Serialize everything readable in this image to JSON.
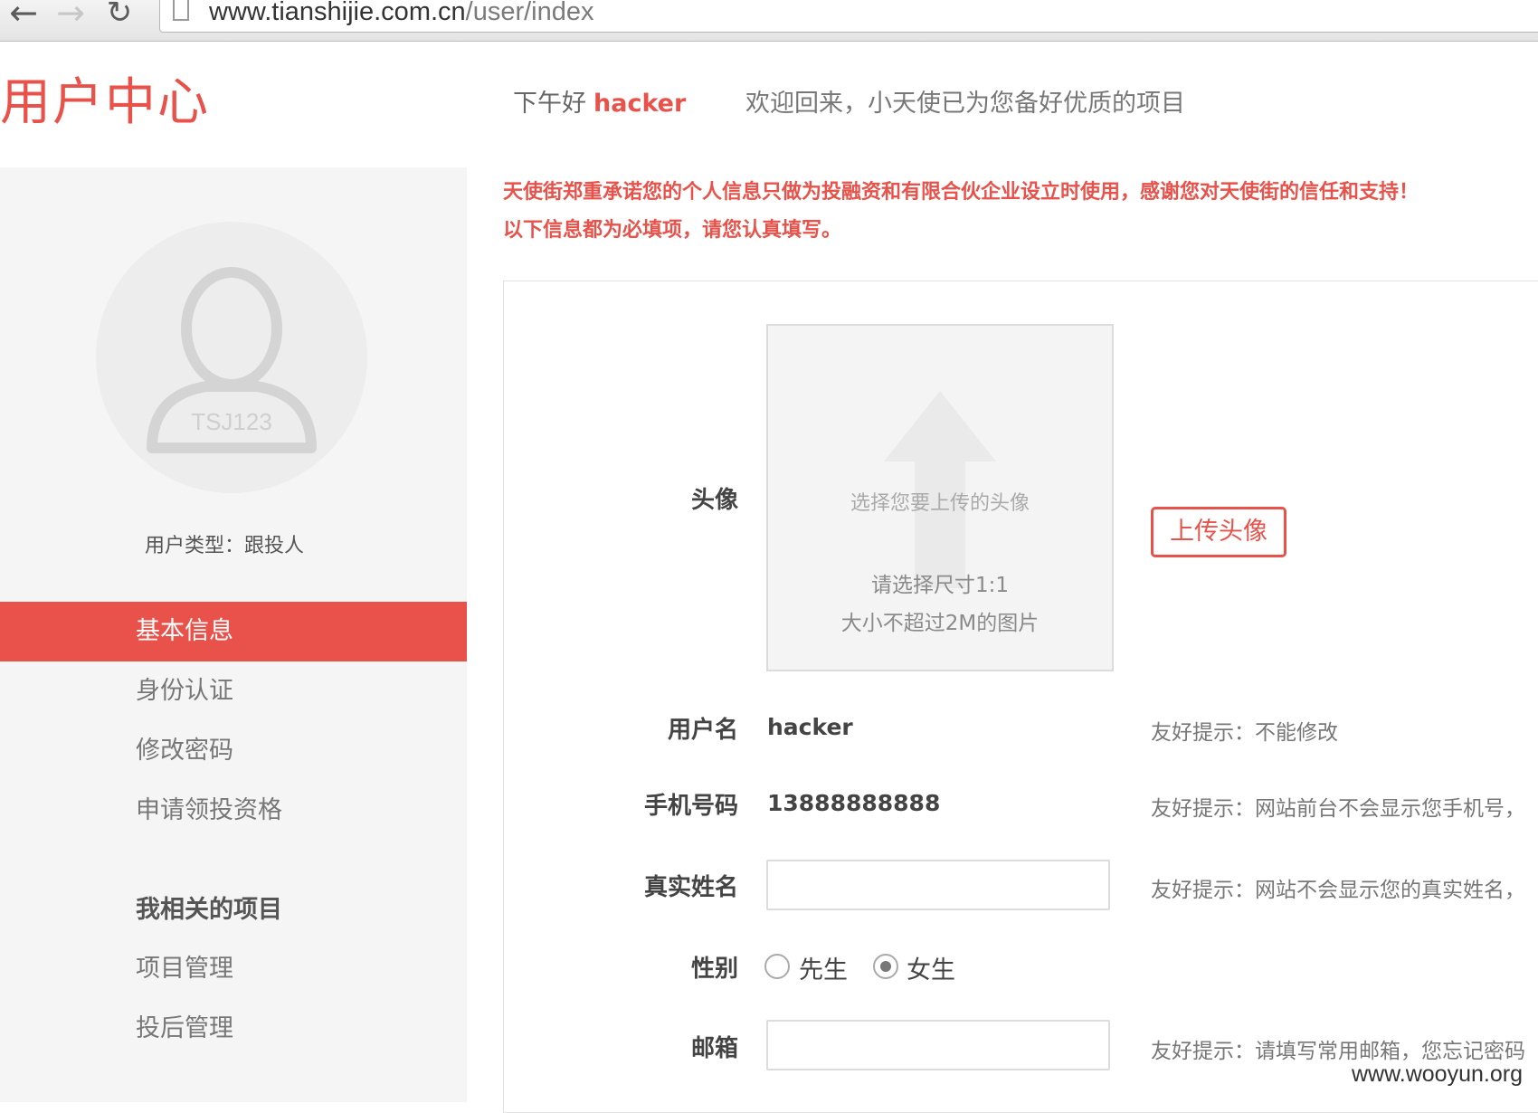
{
  "browser": {
    "url_host": "www.tianshijie.com.cn",
    "url_path": "/user/index",
    "icons": [
      "back-arrow-icon",
      "forward-arrow-icon",
      "reload-icon",
      "page-icon"
    ]
  },
  "header": {
    "title": "用户中心",
    "greeting": "下午好",
    "username": "hacker",
    "welcome": "欢迎回来，小天使已为您备好优质的项目"
  },
  "sidebar": {
    "avatar_text": "TSJ123",
    "user_type": "用户类型：跟投人",
    "menu": [
      {
        "label": "基本信息",
        "active": true
      },
      {
        "label": "身份认证",
        "active": false
      },
      {
        "label": "修改密码",
        "active": false
      },
      {
        "label": "申请领投资格",
        "active": false
      }
    ],
    "section_heading": "我相关的项目",
    "project_menu": [
      {
        "label": "项目管理"
      },
      {
        "label": "投后管理"
      }
    ]
  },
  "notice": {
    "line1": "天使街郑重承诺您的个人信息只做为投融资和有限合伙企业设立时使用，感谢您对天使街的信任和支持！",
    "line2": "以下信息都为必填项，请您认真填写。"
  },
  "form": {
    "avatar": {
      "label": "头像",
      "upload_hint": "选择您要上传的头像",
      "size_line1": "请选择尺寸1:1",
      "size_line2": "大小不超过2M的图片",
      "button": "上传头像"
    },
    "username": {
      "label": "用户名",
      "value": "hacker",
      "hint": "友好提示：不能修改"
    },
    "phone": {
      "label": "手机号码",
      "value": "13888888888",
      "hint": "友好提示：网站前台不会显示您手机号，"
    },
    "real_name": {
      "label": "真实姓名",
      "value": "",
      "hint": "友好提示：网站不会显示您的真实姓名，"
    },
    "gender": {
      "label": "性别",
      "options": [
        {
          "label": "先生",
          "checked": false
        },
        {
          "label": "女生",
          "checked": true
        }
      ]
    },
    "email": {
      "label": "邮箱",
      "value": "",
      "hint": "友好提示：请填写常用邮箱，您忘记密码"
    }
  },
  "watermark": "www.wooyun.org",
  "colors": {
    "accent": "#e8524a",
    "sidebar_bg": "#f5f5f5"
  }
}
